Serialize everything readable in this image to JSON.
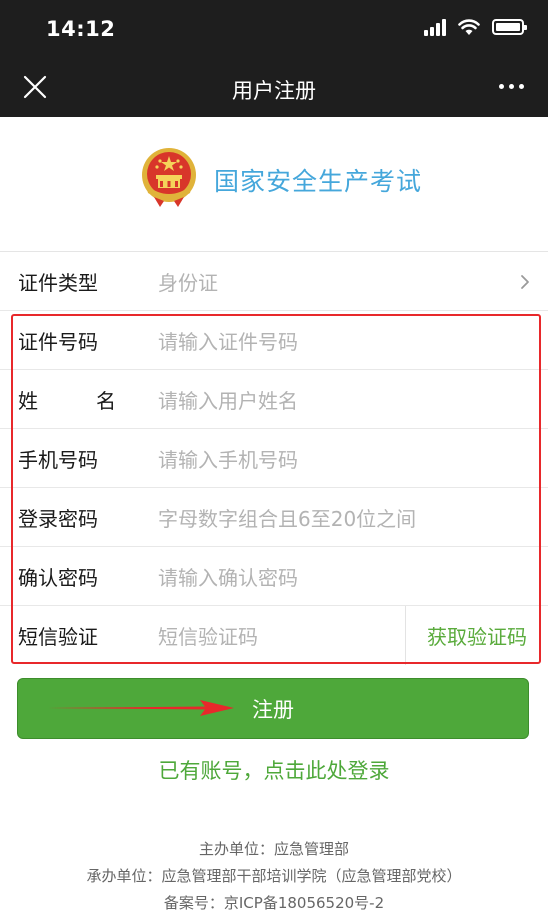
{
  "status_bar": {
    "time": "14:12"
  },
  "nav": {
    "title": "用户注册"
  },
  "brand": {
    "title": "国家安全生产考试"
  },
  "form": {
    "id_type": {
      "label": "证件类型",
      "value": "身份证"
    },
    "id_number": {
      "label": "证件号码",
      "placeholder": "请输入证件号码"
    },
    "name": {
      "label_first": "姓",
      "label_second": "名",
      "placeholder": "请输入用户姓名"
    },
    "phone": {
      "label": "手机号码",
      "placeholder": "请输入手机号码"
    },
    "password": {
      "label": "登录密码",
      "placeholder": "字母数字组合且6至20位之间"
    },
    "confirm_password": {
      "label": "确认密码",
      "placeholder": "请输入确认密码"
    },
    "sms": {
      "label": "短信验证",
      "placeholder": "短信验证码",
      "button": "获取验证码"
    }
  },
  "register_button": "注册",
  "login_link": "已有账号，点击此处登录",
  "footer": {
    "sponsor": "主办单位：应急管理部",
    "organizer": "承办单位：应急管理部干部培训学院（应急管理部党校）",
    "icp": "备案号：京ICP备18056520号-2"
  },
  "colors": {
    "accent_green": "#4ea83a",
    "brand_blue": "#45a7db",
    "highlight_red": "#e8282b"
  },
  "icons": [
    "close-icon",
    "more-icon",
    "emblem-icon",
    "chevron-right-icon",
    "arrow-icon"
  ]
}
